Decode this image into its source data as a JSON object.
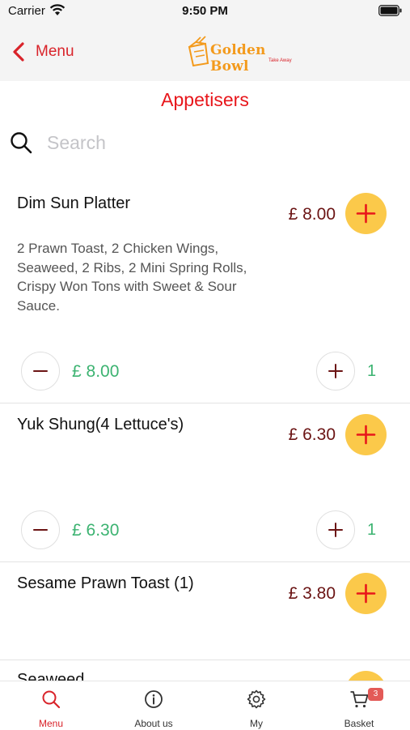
{
  "status_bar": {
    "carrier": "Carrier",
    "time": "9:50 PM"
  },
  "nav": {
    "back_label": "Menu",
    "logo_text": "Golden Bowl",
    "logo_sub": "Take Away"
  },
  "page_title": "Appetisers",
  "search": {
    "placeholder": "Search",
    "value": ""
  },
  "items": [
    {
      "name": "Dim Sun Platter",
      "price": "£ 8.00",
      "description": "2 Prawn Toast, 2 Chicken Wings, Seaweed, 2 Ribs, 2 Mini Spring Rolls, Crispy Won Tons with Sweet & Sour Sauce.",
      "line_total": "£ 8.00",
      "quantity": "1"
    },
    {
      "name": "Yuk Shung(4 Lettuce's)",
      "price": "£ 6.30",
      "description": "",
      "line_total": "£ 6.30",
      "quantity": "1"
    },
    {
      "name": "Sesame Prawn Toast (1)",
      "price": "£ 3.80",
      "description": ""
    },
    {
      "name": "Seaweed"
    }
  ],
  "tabs": [
    {
      "label": "Menu",
      "icon": "search-icon",
      "active": true
    },
    {
      "label": "About us",
      "icon": "info-icon",
      "active": false
    },
    {
      "label": "My",
      "icon": "gear-icon",
      "active": false
    },
    {
      "label": "Basket",
      "icon": "cart-icon",
      "active": false,
      "badge": "3"
    }
  ],
  "colors": {
    "accent_red": "#d9232a",
    "add_yellow": "#fbc94a",
    "price_maroon": "#6b1414",
    "total_green": "#3cb371",
    "badge_red": "#e35a57"
  }
}
